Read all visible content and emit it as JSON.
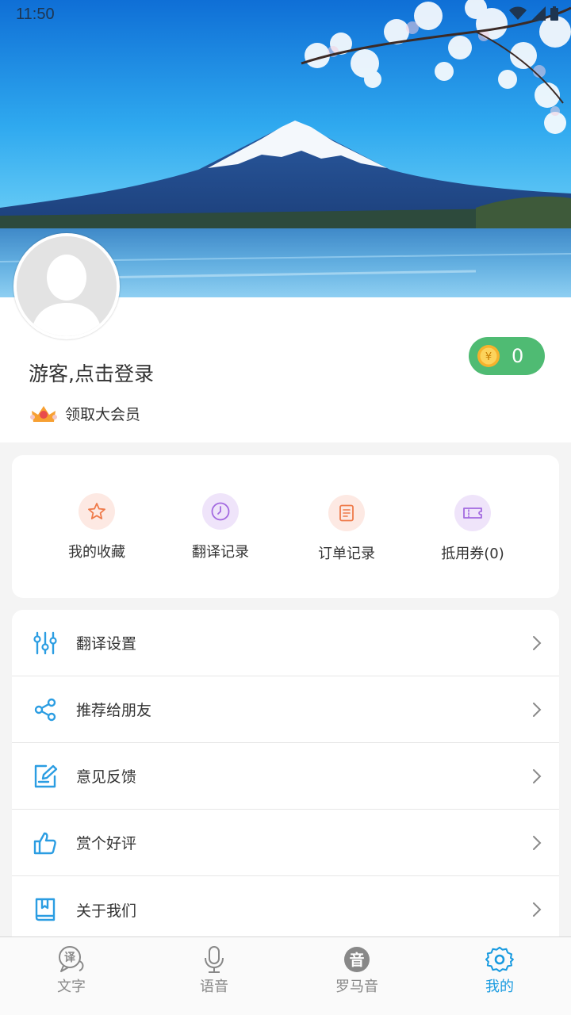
{
  "status_bar": {
    "time": "11:50"
  },
  "profile": {
    "login_text": "游客,点击登录",
    "vip_text": "领取大会员",
    "coin_value": "0"
  },
  "quick_actions": [
    {
      "label": "我的收藏",
      "icon": "star-icon"
    },
    {
      "label": "翻译记录",
      "icon": "clock-icon"
    },
    {
      "label": "订单记录",
      "icon": "document-icon"
    },
    {
      "label": "抵用券(0)",
      "icon": "ticket-icon"
    }
  ],
  "menu": [
    {
      "label": "翻译设置",
      "icon": "sliders-icon"
    },
    {
      "label": "推荐给朋友",
      "icon": "share-icon"
    },
    {
      "label": "意见反馈",
      "icon": "edit-icon"
    },
    {
      "label": "赏个好评",
      "icon": "thumbs-up-icon"
    },
    {
      "label": "关于我们",
      "icon": "book-icon"
    }
  ],
  "bottom_nav": [
    {
      "label": "文字",
      "icon": "translate-icon",
      "active": false
    },
    {
      "label": "语音",
      "icon": "microphone-icon",
      "active": false
    },
    {
      "label": "罗马音",
      "icon": "romaji-icon",
      "icon_text": "音",
      "active": false
    },
    {
      "label": "我的",
      "icon": "settings-icon",
      "active": true
    }
  ],
  "colors": {
    "accent": "#1a9be0",
    "coin_pill": "#4fbb73",
    "menu_icon": "#2b9de2"
  }
}
